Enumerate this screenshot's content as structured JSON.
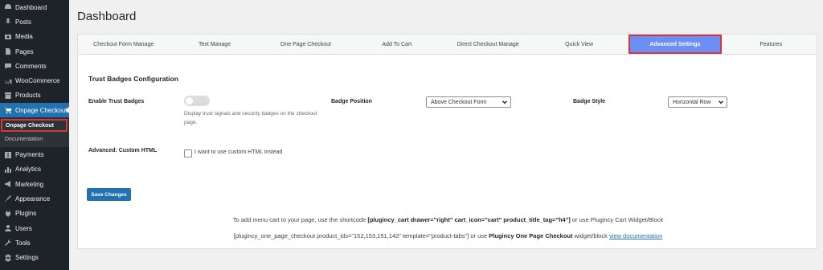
{
  "sidebar": {
    "items": [
      {
        "label": "Dashboard",
        "icon": "dashboard-icon"
      },
      {
        "label": "Posts",
        "icon": "pin-icon"
      },
      {
        "label": "Media",
        "icon": "media-icon"
      },
      {
        "label": "Pages",
        "icon": "page-icon"
      },
      {
        "label": "Comments",
        "icon": "comment-icon"
      },
      {
        "label": "WooCommerce",
        "icon": "woocommerce-icon"
      },
      {
        "label": "Products",
        "icon": "archive-icon"
      },
      {
        "label": "Onpage Checkout",
        "icon": "cart-icon"
      }
    ],
    "submenu": [
      {
        "label": "Onpage Checkout"
      },
      {
        "label": "Documentation"
      }
    ],
    "items_after": [
      {
        "label": "Payments",
        "icon": "dollar-icon"
      },
      {
        "label": "Analytics",
        "icon": "bar-chart-icon"
      },
      {
        "label": "Marketing",
        "icon": "megaphone-icon"
      },
      {
        "label": "Appearance",
        "icon": "paintbrush-icon"
      },
      {
        "label": "Plugins",
        "icon": "plug-icon"
      },
      {
        "label": "Users",
        "icon": "user-icon"
      },
      {
        "label": "Tools",
        "icon": "wrench-icon"
      },
      {
        "label": "Settings",
        "icon": "settings-icon"
      }
    ]
  },
  "page": {
    "title": "Dashboard"
  },
  "tabs": [
    "Checkout Form Manage",
    "Text Manage",
    "One Page Checkout",
    "Add To Cart",
    "Direct Checkout Manage",
    "Quick View",
    "Advanced Settings",
    "Features"
  ],
  "active_tab": "Advanced Settings",
  "settings": {
    "section_title": "Trust Badges Configuration",
    "enable_label": "Enable Trust Badges",
    "enable_desc": "Display trust signals and security badges on the checkout page.",
    "position_label": "Badge Position",
    "position_value": "Above Checkout Form",
    "style_label": "Badge Style",
    "style_value": "Horizontal Row",
    "custom_label": "Advanced: Custom HTML",
    "custom_check_label": "I want to use custom HTML instead",
    "save_label": "Save Changes"
  },
  "info": {
    "line1_pre": "To add menu cart to your page, use the shortcode ",
    "line1_code": "[plugincy_cart drawer=\"right\" cart_icon=\"cart\" product_title_tag=\"h4\"]",
    "line1_post": " or use Plugincy Cart Widget/Block",
    "line2_pre": "[plugincy_one_page_checkout product_ids=\"152,153,151,142\" template=\"product-tabs\"] or use ",
    "line2_bold": "Plugincy One Page Checkout",
    "line2_mid": " widget/block ",
    "line2_link": "view documentation"
  },
  "colors": {
    "accent": "#2271b1",
    "active_tab": "#6b8ff5",
    "highlight": "#d63638",
    "sidebar": "#1d2327"
  }
}
